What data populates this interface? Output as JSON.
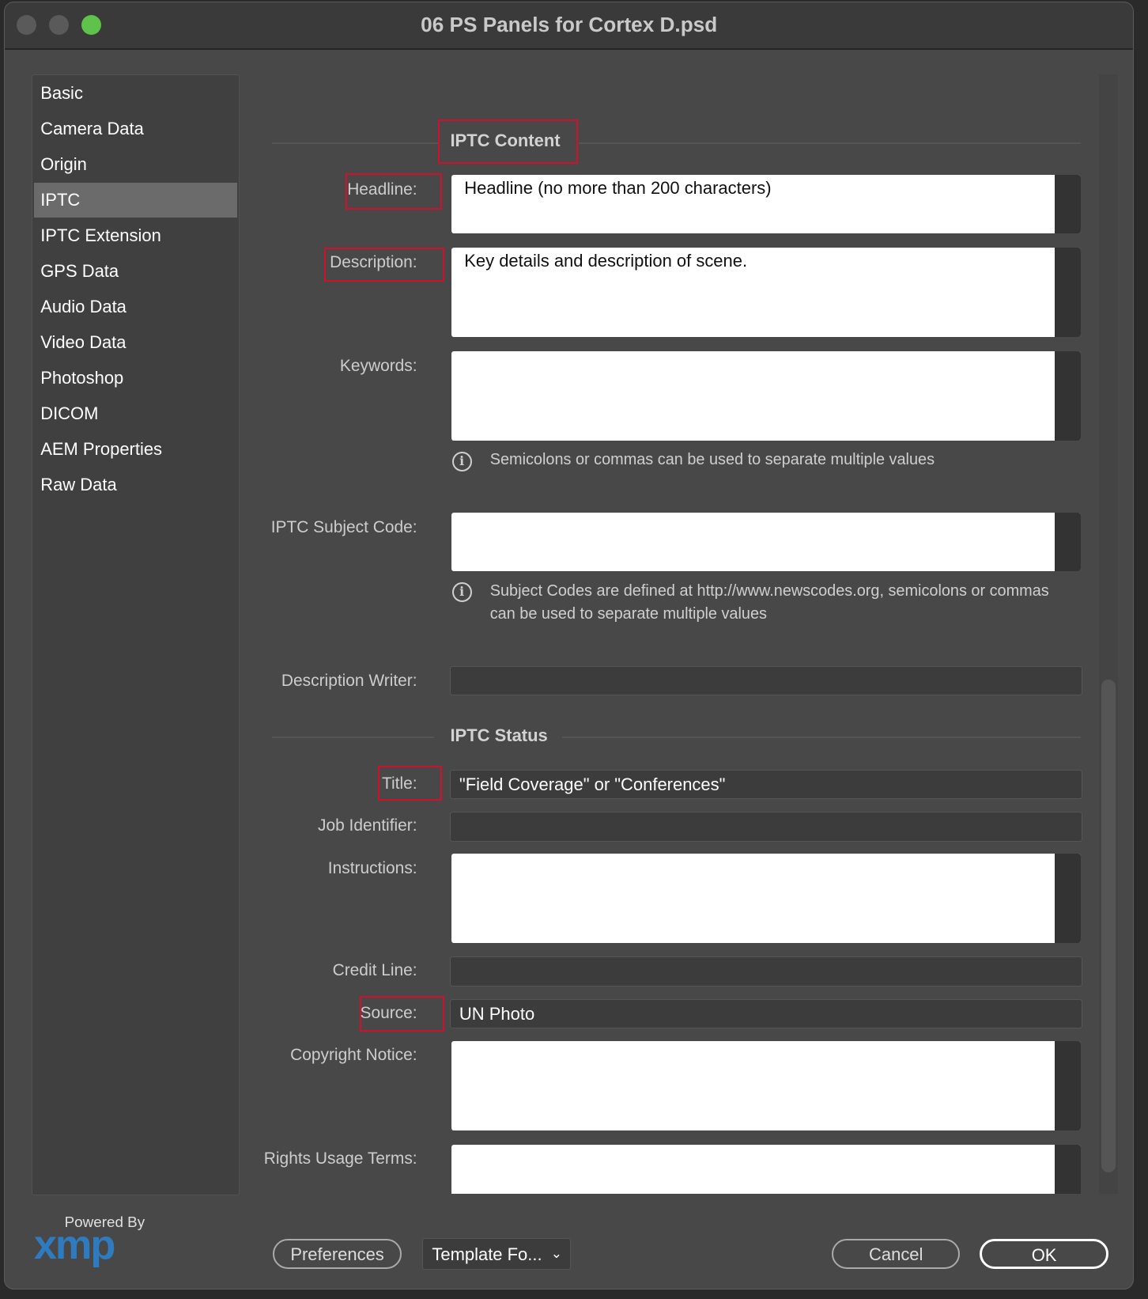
{
  "window": {
    "title": "06 PS Panels for Cortex D.psd",
    "traffic_lights": [
      "#5a5a5a",
      "#5a5a5a",
      "#5fc24a"
    ]
  },
  "sidebar": {
    "items": [
      {
        "label": "Basic"
      },
      {
        "label": "Camera Data"
      },
      {
        "label": "Origin"
      },
      {
        "label": "IPTC",
        "selected": true
      },
      {
        "label": "IPTC Extension"
      },
      {
        "label": "GPS Data"
      },
      {
        "label": "Audio Data"
      },
      {
        "label": "Video Data"
      },
      {
        "label": "Photoshop"
      },
      {
        "label": "DICOM"
      },
      {
        "label": "AEM Properties"
      },
      {
        "label": "Raw Data"
      }
    ]
  },
  "content": {
    "section1": "IPTC Content",
    "headline": {
      "label": "Headline:",
      "value": "Headline (no more than 200 characters)"
    },
    "description": {
      "label": "Description:",
      "value": "Key details and description of scene."
    },
    "keywords": {
      "label": "Keywords:",
      "value": "",
      "hint": "Semicolons or commas can be used to separate multiple values"
    },
    "subject_code": {
      "label": "IPTC Subject Code:",
      "value": "",
      "hint1": "Subject Codes are defined at http://www.newscodes.org, semicolons or commas",
      "hint2": "can be used to separate multiple values"
    },
    "description_writer": {
      "label": "Description Writer:",
      "value": ""
    },
    "section2": "IPTC Status",
    "title": {
      "label": "Title:",
      "value": "\"Field Coverage\" or \"Conferences\""
    },
    "job_identifier": {
      "label": "Job Identifier:",
      "value": ""
    },
    "instructions": {
      "label": "Instructions:",
      "value": ""
    },
    "credit_line": {
      "label": "Credit Line:",
      "value": ""
    },
    "source": {
      "label": "Source:",
      "value": "UN Photo"
    },
    "copyright_notice": {
      "label": "Copyright Notice:",
      "value": ""
    },
    "rights_usage_terms": {
      "label": "Rights Usage Terms:",
      "value": ""
    }
  },
  "footer": {
    "powered_by": "Powered By",
    "logo": "xmp",
    "preferences": "Preferences",
    "template": "Template Fo...",
    "cancel": "Cancel",
    "ok": "OK"
  },
  "colors": {
    "highlight": "#d0102c",
    "logo": "#2e7bbf",
    "selected": "#6b6b6b"
  }
}
